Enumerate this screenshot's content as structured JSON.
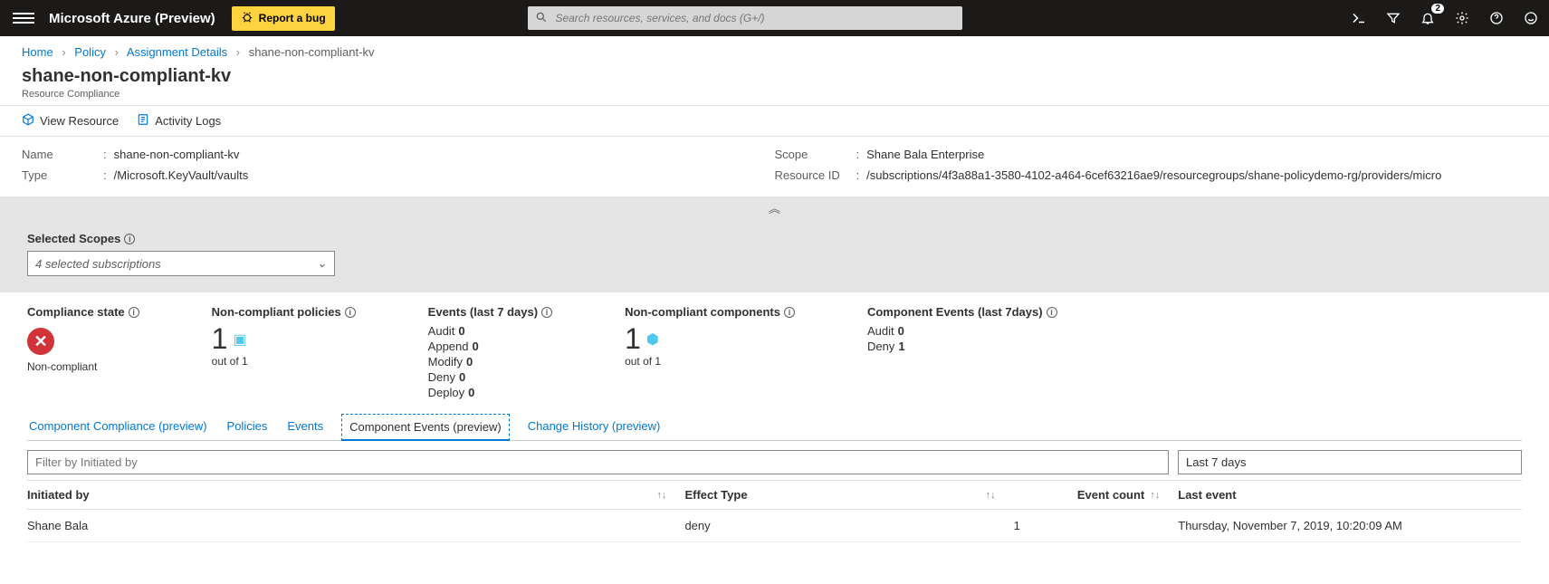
{
  "topbar": {
    "brand": "Microsoft Azure (Preview)",
    "bug_label": "Report a bug",
    "search_placeholder": "Search resources, services, and docs (G+/)",
    "notification_badge": "2"
  },
  "breadcrumb": {
    "items": [
      "Home",
      "Policy",
      "Assignment Details"
    ],
    "current": "shane-non-compliant-kv"
  },
  "title": {
    "main": "shane-non-compliant-kv",
    "sub": "Resource Compliance"
  },
  "toolbar": {
    "view_resource": "View Resource",
    "activity_logs": "Activity Logs"
  },
  "properties": {
    "left": {
      "name_k": "Name",
      "name_v": "shane-non-compliant-kv",
      "type_k": "Type",
      "type_v": "/Microsoft.KeyVault/vaults"
    },
    "right": {
      "scope_k": "Scope",
      "scope_v": "Shane Bala Enterprise",
      "rid_k": "Resource ID",
      "rid_v": "/subscriptions/4f3a88a1-3580-4102-a464-6cef63216ae9/resourcegroups/shane-policydemo-rg/providers/micro"
    }
  },
  "scopes": {
    "label": "Selected Scopes",
    "value": "4 selected subscriptions"
  },
  "stats": {
    "compliance": {
      "label": "Compliance state",
      "status": "Non-compliant"
    },
    "nc_policies": {
      "label": "Non-compliant policies",
      "value": "1",
      "sub": "out of 1"
    },
    "events7": {
      "label": "Events (last 7 days)",
      "rows": [
        {
          "k": "Audit",
          "v": "0"
        },
        {
          "k": "Append",
          "v": "0"
        },
        {
          "k": "Modify",
          "v": "0"
        },
        {
          "k": "Deny",
          "v": "0"
        },
        {
          "k": "Deploy",
          "v": "0"
        }
      ]
    },
    "nc_components": {
      "label": "Non-compliant components",
      "value": "1",
      "sub": "out of 1"
    },
    "comp_events7": {
      "label": "Component Events (last 7days)",
      "rows": [
        {
          "k": "Audit",
          "v": "0"
        },
        {
          "k": "Deny",
          "v": "1"
        }
      ]
    }
  },
  "tabs": {
    "t0": "Component Compliance (preview)",
    "t1": "Policies",
    "t2": "Events",
    "t3": "Component Events (preview)",
    "t4": "Change History (preview)"
  },
  "filter": {
    "placeholder": "Filter by Initiated by",
    "range": "Last 7 days"
  },
  "table": {
    "headers": {
      "init": "Initiated by",
      "effect": "Effect Type",
      "count": "Event count",
      "last": "Last event"
    },
    "rows": [
      {
        "init": "Shane Bala",
        "effect": "deny",
        "count": "1",
        "last": "Thursday, November 7, 2019, 10:20:09 AM"
      }
    ]
  }
}
